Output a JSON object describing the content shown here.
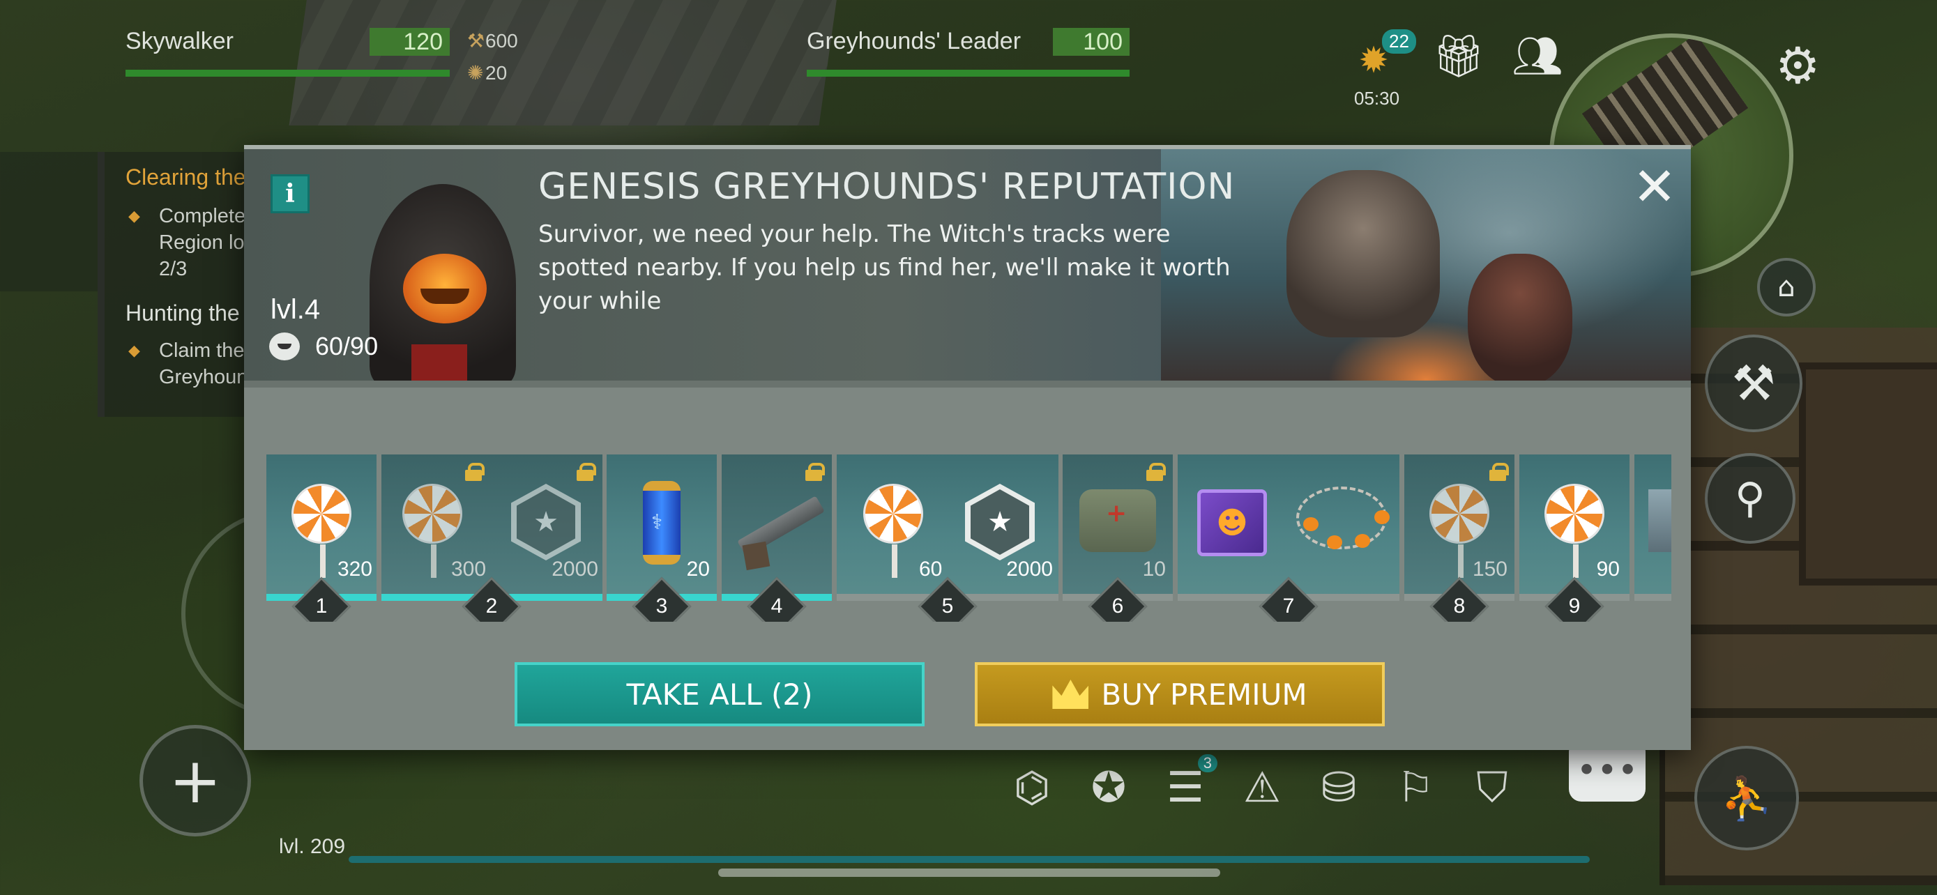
{
  "hud": {
    "player_name": "Skywalker",
    "player_hp": "120",
    "stat_attack": "600",
    "stat_defense": "20",
    "enemy_name": "Greyhounds' Leader",
    "enemy_hp": "100",
    "discount_badge": "22",
    "discount_timer": "05:30"
  },
  "quests": {
    "title1": "Clearing the",
    "line1a": "Complete",
    "line1b": "Region loc",
    "line1c": "2/3",
    "title2": "Hunting the",
    "line2a": "Claim the",
    "line2b": "Greyhound"
  },
  "modal": {
    "title": "GENESIS GREYHOUNDS' REPUTATION",
    "description": "Survivor, we need your help. The Witch's tracks were spotted nearby. If you help us find her, we'll make it worth your while",
    "level": "lvl.4",
    "progress": "60/90",
    "take_all_label": "TAKE ALL (2)",
    "buy_premium_label": "BUY PREMIUM"
  },
  "rewards": [
    {
      "step": "1",
      "free_amount": "320",
      "premium_amount": "",
      "claimed": true
    },
    {
      "step": "2",
      "free_amount": "300",
      "premium_amount": "2000",
      "claimed": true
    },
    {
      "step": "3",
      "free_amount": "20",
      "premium_amount": "",
      "claimed": true
    },
    {
      "step": "4",
      "free_amount": "",
      "premium_amount": "",
      "claimed": true
    },
    {
      "step": "5",
      "free_amount": "60",
      "premium_amount": "2000",
      "claimed": false
    },
    {
      "step": "6",
      "free_amount": "10",
      "premium_amount": "",
      "claimed": false
    },
    {
      "step": "7",
      "free_amount": "",
      "premium_amount": "",
      "claimed": false
    },
    {
      "step": "8",
      "free_amount": "150",
      "premium_amount": "",
      "claimed": false
    },
    {
      "step": "9",
      "free_amount": "90",
      "premium_amount": "",
      "claimed": false
    }
  ],
  "bottom": {
    "player_level": "lvl. 209",
    "tasks_badge": "3"
  },
  "icons": [
    "settings-icon",
    "gift-icon",
    "friends-icon",
    "discount-icon",
    "close-icon",
    "info-icon",
    "lollipop-icon",
    "emblem-icon",
    "capsule-icon",
    "shotgun-icon",
    "medkit-bag-icon",
    "chip-icon",
    "garland-icon",
    "lock-icon",
    "crown-icon"
  ],
  "colors": {
    "take_all": "#20a59a",
    "premium": "#c59a1f",
    "progress_fill": "#38d6cf",
    "quest_title": "#e2a43a"
  }
}
